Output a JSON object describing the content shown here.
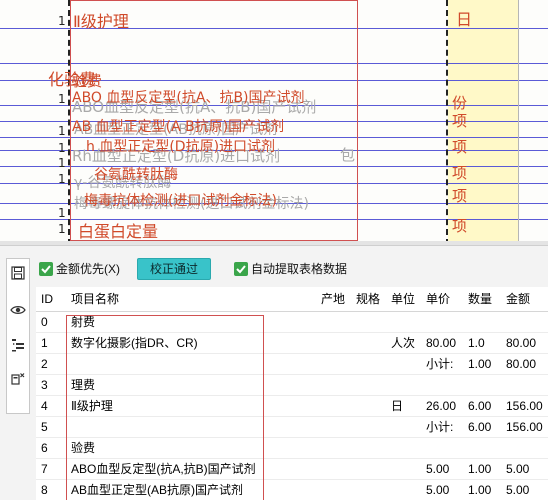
{
  "scan": {
    "lines": [
      {
        "text": "Ⅱ级护理",
        "color": "red"
      },
      {
        "text": "化验费",
        "color": "red"
      },
      {
        "text": "验费",
        "color": "red"
      },
      {
        "text": "ABO 血型反定型(抗A、抗B)国产试剂",
        "color": "red"
      },
      {
        "text": "ABO血型反定型(抗A、抗B)国产试剂",
        "color": "gray"
      },
      {
        "text": "AB 血型正定型(A B抗原)国产试剂",
        "color": "red"
      },
      {
        "text": "AB血型正定型(AB抗原)国产试剂",
        "color": "gray"
      },
      {
        "text": "h 血型正定型(D抗原)进口试剂",
        "color": "red"
      },
      {
        "text": "Rh血型正定型(D抗原)进口试剂",
        "color": "gray"
      },
      {
        "text": "谷氨酰转肽酶",
        "color": "red"
      },
      {
        "text": "γ-谷氨酰转肽酶",
        "color": "gray"
      },
      {
        "text": "梅毒抗体检测(进口试剂金标法)",
        "color": "red"
      },
      {
        "text": "梅毒螺旋体抗体检测(进口试剂金标法)",
        "color": "gray"
      },
      {
        "text": "白蛋白定量",
        "color": "red"
      },
      {
        "text": "日",
        "color": "red"
      },
      {
        "text": "份",
        "color": "red"
      },
      {
        "text": "项",
        "color": "red"
      },
      {
        "text": "包",
        "color": "gray"
      }
    ],
    "row_numbers": [
      "1",
      "1",
      "1",
      "1",
      "1",
      "1",
      "1",
      "1"
    ]
  },
  "toolbar": {
    "rail_icons": [
      "save-icon",
      "eye-icon",
      "list-indent-icon",
      "delete-row-icon"
    ]
  },
  "options": {
    "amount_first_label": "金额优先(X)",
    "verify_button": "校正通过",
    "auto_extract_label": "自动提取表格数据"
  },
  "table": {
    "columns": [
      "ID",
      "项目名称",
      "产地",
      "规格",
      "单位",
      "单价",
      "数量",
      "金额"
    ],
    "rows": [
      [
        "0",
        "射费",
        "",
        "",
        "",
        "",
        "",
        ""
      ],
      [
        "1",
        "数字化摄影(指DR、CR)",
        "",
        "",
        "人次",
        "80.00",
        "1.0",
        "80.00"
      ],
      [
        "2",
        "",
        "",
        "",
        "",
        "小计:",
        "1.00",
        "80.00"
      ],
      [
        "3",
        "理费",
        "",
        "",
        "",
        "",
        "",
        ""
      ],
      [
        "4",
        "Ⅱ级护理",
        "",
        "",
        "日",
        "26.00",
        "6.00",
        "156.00"
      ],
      [
        "5",
        "",
        "",
        "",
        "",
        "小计:",
        "6.00",
        "156.00"
      ],
      [
        "6",
        "验费",
        "",
        "",
        "",
        "",
        "",
        ""
      ],
      [
        "7",
        "ABO血型反定型(抗A,抗B)国产试剂",
        "",
        "",
        "",
        "5.00",
        "1.00",
        "5.00"
      ],
      [
        "8",
        "AB血型正定型(AB抗原)国产试剂",
        "",
        "",
        "",
        "5.00",
        "1.00",
        "5.00"
      ]
    ]
  },
  "colors": {
    "accent_button": "#39c3c9",
    "checkbox": "#3aa54a",
    "ocr_red": "#d04a2a",
    "highlight_yellow": "#fff9c8"
  }
}
